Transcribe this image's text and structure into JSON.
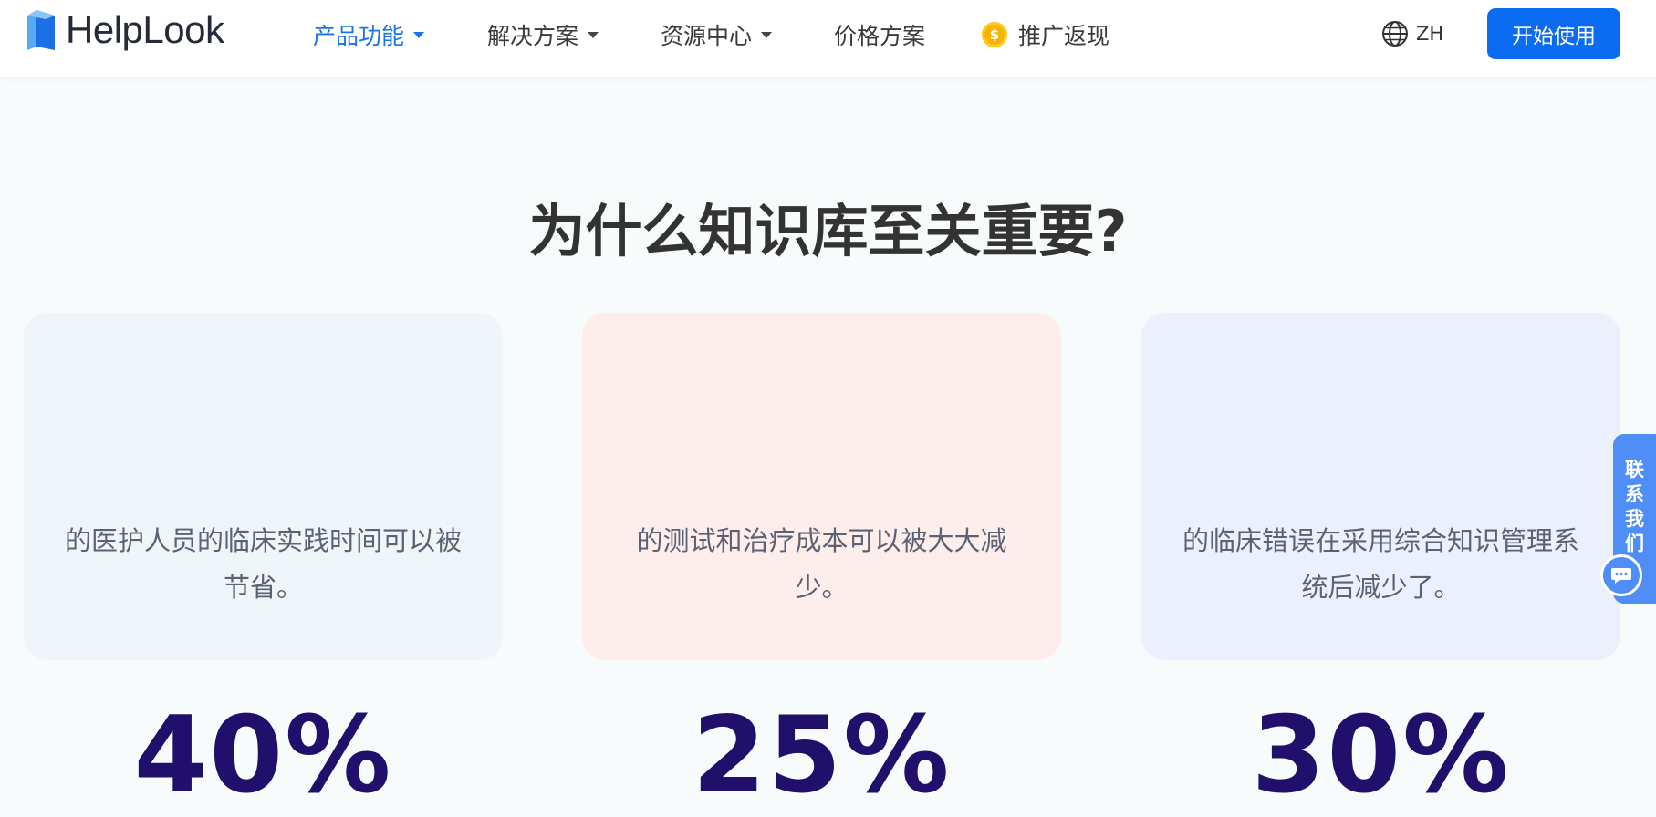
{
  "header": {
    "brand": "HelpLook",
    "nav": [
      {
        "label": "产品功能",
        "has_dropdown": true,
        "active": true
      },
      {
        "label": "解决方案",
        "has_dropdown": true,
        "active": false
      },
      {
        "label": "资源中心",
        "has_dropdown": true,
        "active": false
      },
      {
        "label": "价格方案",
        "has_dropdown": false,
        "active": false
      },
      {
        "label": "推广返现",
        "has_dropdown": false,
        "active": false,
        "icon": "coin-icon"
      }
    ],
    "coin_symbol": "$",
    "language": "ZH",
    "cta_label": "开始使用"
  },
  "section": {
    "title": "为什么知识库至关重要?",
    "cards": [
      {
        "value": "40%",
        "desc_line1": "的医护人员的临床实践时间可以被",
        "desc_line2": "节省。",
        "bg": "#eef6fa"
      },
      {
        "value": "25%",
        "desc_line1": "的测试和治疗成本可以被大大减",
        "desc_line2": "少。",
        "bg": "#fdeeec"
      },
      {
        "value": "30%",
        "desc_line1": "的临床错误在采用综合知识管理系",
        "desc_line2": "统后减少了。",
        "bg": "#ebf1fc"
      }
    ]
  },
  "contact": {
    "chars": [
      "联",
      "系",
      "我",
      "们"
    ]
  },
  "colors": {
    "accent": "#0b6cf2",
    "stat": "#21106b",
    "nav_active": "#1a73e8"
  }
}
